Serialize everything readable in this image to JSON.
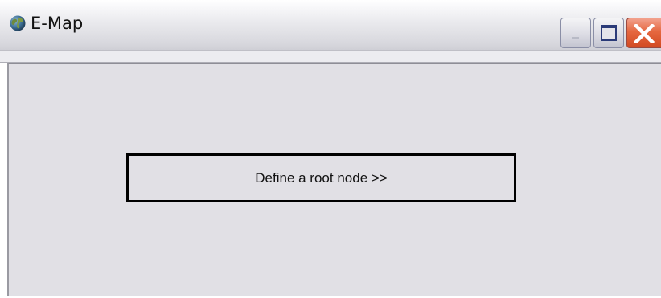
{
  "window": {
    "title": "E-Map",
    "app_icon": "globe-icon",
    "controls": {
      "minimize_icon": "minimize-icon",
      "maximize_icon": "maximize-icon",
      "close_icon": "close-icon"
    }
  },
  "main": {
    "root_node_button_label": "Define a root node >>"
  },
  "colors": {
    "client_background": "#e1e0e5",
    "button_border": "#000000",
    "close_button": "#e5673f"
  }
}
